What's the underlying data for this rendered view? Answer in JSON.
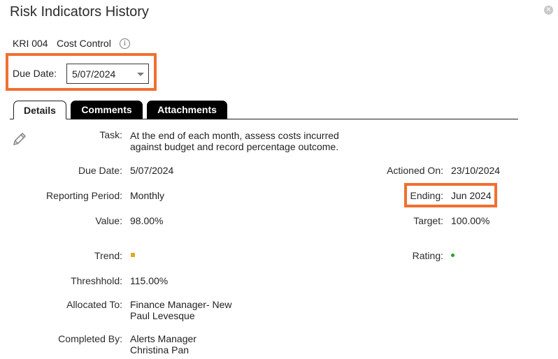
{
  "dialog": {
    "title": "Risk Indicators History",
    "close_icon": "close-icon"
  },
  "kri": {
    "code": "KRI 004",
    "name": "Cost Control",
    "info_icon": "i"
  },
  "due_date_filter": {
    "label": "Due Date:",
    "value": "5/07/2024"
  },
  "tabs": [
    {
      "label": "Details",
      "active": true
    },
    {
      "label": "Comments",
      "active": false
    },
    {
      "label": "Attachments",
      "active": false
    }
  ],
  "details": {
    "task_label": "Task:",
    "task_line1": "At the end of each month, assess costs incurred",
    "task_line2": "against budget and record percentage outcome.",
    "due_date_label": "Due Date:",
    "due_date": "5/07/2024",
    "reporting_period_label": "Reporting Period:",
    "reporting_period": "Monthly",
    "value_label": "Value:",
    "value": "98.00%",
    "trend_label": "Trend:",
    "threshold_label": "Threshhold:",
    "threshold": "115.00%",
    "allocated_to_label": "Allocated To:",
    "allocated_to_line1": "Finance Manager- New",
    "allocated_to_line2": "Paul Levesque",
    "completed_by_label": "Completed By:",
    "completed_by_line1": "Alerts Manager",
    "completed_by_line2": "Christina Pan",
    "actioned_on_label": "Actioned On:",
    "actioned_on": "23/10/2024",
    "ending_label": "Ending:",
    "ending": "Jun 2024",
    "target_label": "Target:",
    "target": "100.00%",
    "rating_label": "Rating:"
  },
  "colors": {
    "highlight": "#f07030",
    "trend_marker": "#e0a82e",
    "rating_marker": "#2aa02a"
  }
}
